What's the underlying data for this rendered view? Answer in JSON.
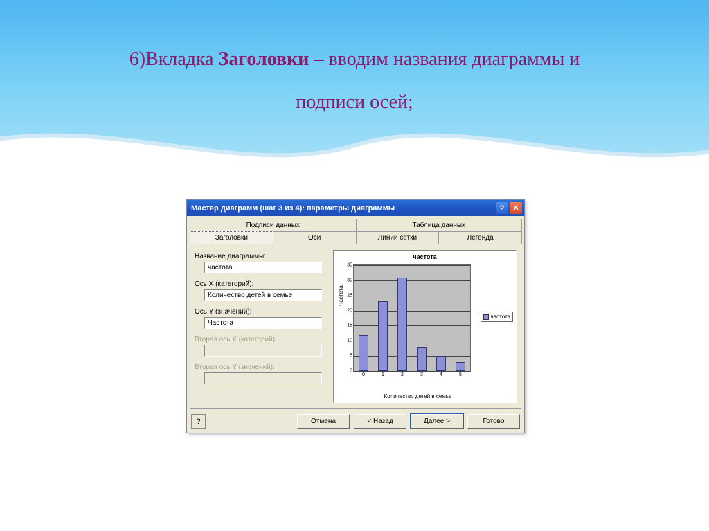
{
  "slide": {
    "title_prefix": "6)Вкладка ",
    "title_bold": "Заголовки",
    "title_suffix1": " – вводим названия диаграммы и",
    "title_line2": "подписи осей;"
  },
  "dialog": {
    "title": "Мастер диаграмм (шаг 3 из 4): параметры диаграммы",
    "help_glyph": "?",
    "close_glyph": "✕",
    "tabs_top": {
      "data_labels": "Подписи данных",
      "data_table": "Таблица данных"
    },
    "tabs_bottom": {
      "titles": "Заголовки",
      "axes": "Оси",
      "gridlines": "Линии сетки",
      "legend": "Легенда"
    },
    "form": {
      "chart_title_label": "Название диаграммы:",
      "chart_title_value": "частота",
      "x_axis_label": "Ось X (категорий):",
      "x_axis_value": "Количество детей в семье",
      "y_axis_label": "Ось Y (значений):",
      "y_axis_value": "Частота",
      "x2_label": "Вторая ось X (категорий):",
      "y2_label": "Вторая ось Y (значений):"
    },
    "buttons": {
      "help": "?",
      "cancel": "Отмена",
      "back": "< Назад",
      "next": "Далее >",
      "finish": "Готово"
    }
  },
  "chart_data": {
    "type": "bar",
    "title": "частота",
    "xlabel": "Количество детей в семье",
    "ylabel": "Частота",
    "categories": [
      "0",
      "1",
      "2",
      "3",
      "4",
      "5"
    ],
    "values": [
      12,
      23,
      31,
      8,
      5,
      3
    ],
    "ylim": [
      0,
      35
    ],
    "yticks": [
      0,
      5,
      10,
      15,
      20,
      25,
      30,
      35
    ],
    "legend": "частота"
  }
}
